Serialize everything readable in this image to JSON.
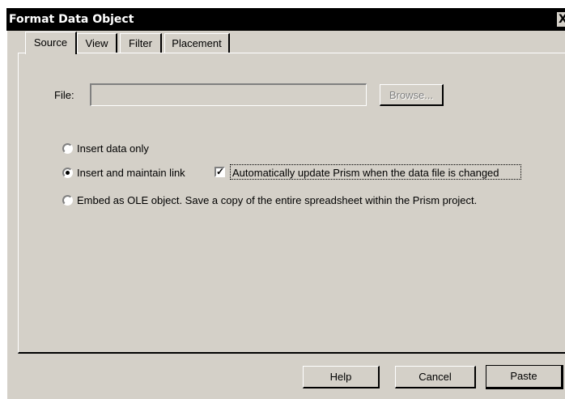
{
  "window": {
    "title": "Format Data Object",
    "close_glyph": "X"
  },
  "tabs": [
    {
      "label": "Source",
      "active": true
    },
    {
      "label": "View",
      "active": false
    },
    {
      "label": "Filter",
      "active": false
    },
    {
      "label": "Placement",
      "active": false
    }
  ],
  "file": {
    "label": "File:",
    "value": "",
    "browse_label": "Browse..."
  },
  "options": {
    "insert_only": {
      "label": "Insert data only",
      "selected": false
    },
    "insert_link": {
      "label": "Insert and maintain link",
      "selected": true
    },
    "embed_ole": {
      "label": "Embed as OLE object. Save a copy of the entire spreadsheet within the Prism project.",
      "selected": false
    }
  },
  "auto_update": {
    "label": "Automatically update Prism when the data file is changed",
    "checked": true,
    "check_glyph": "✓"
  },
  "buttons": {
    "help": "Help",
    "cancel": "Cancel",
    "paste": "Paste"
  }
}
